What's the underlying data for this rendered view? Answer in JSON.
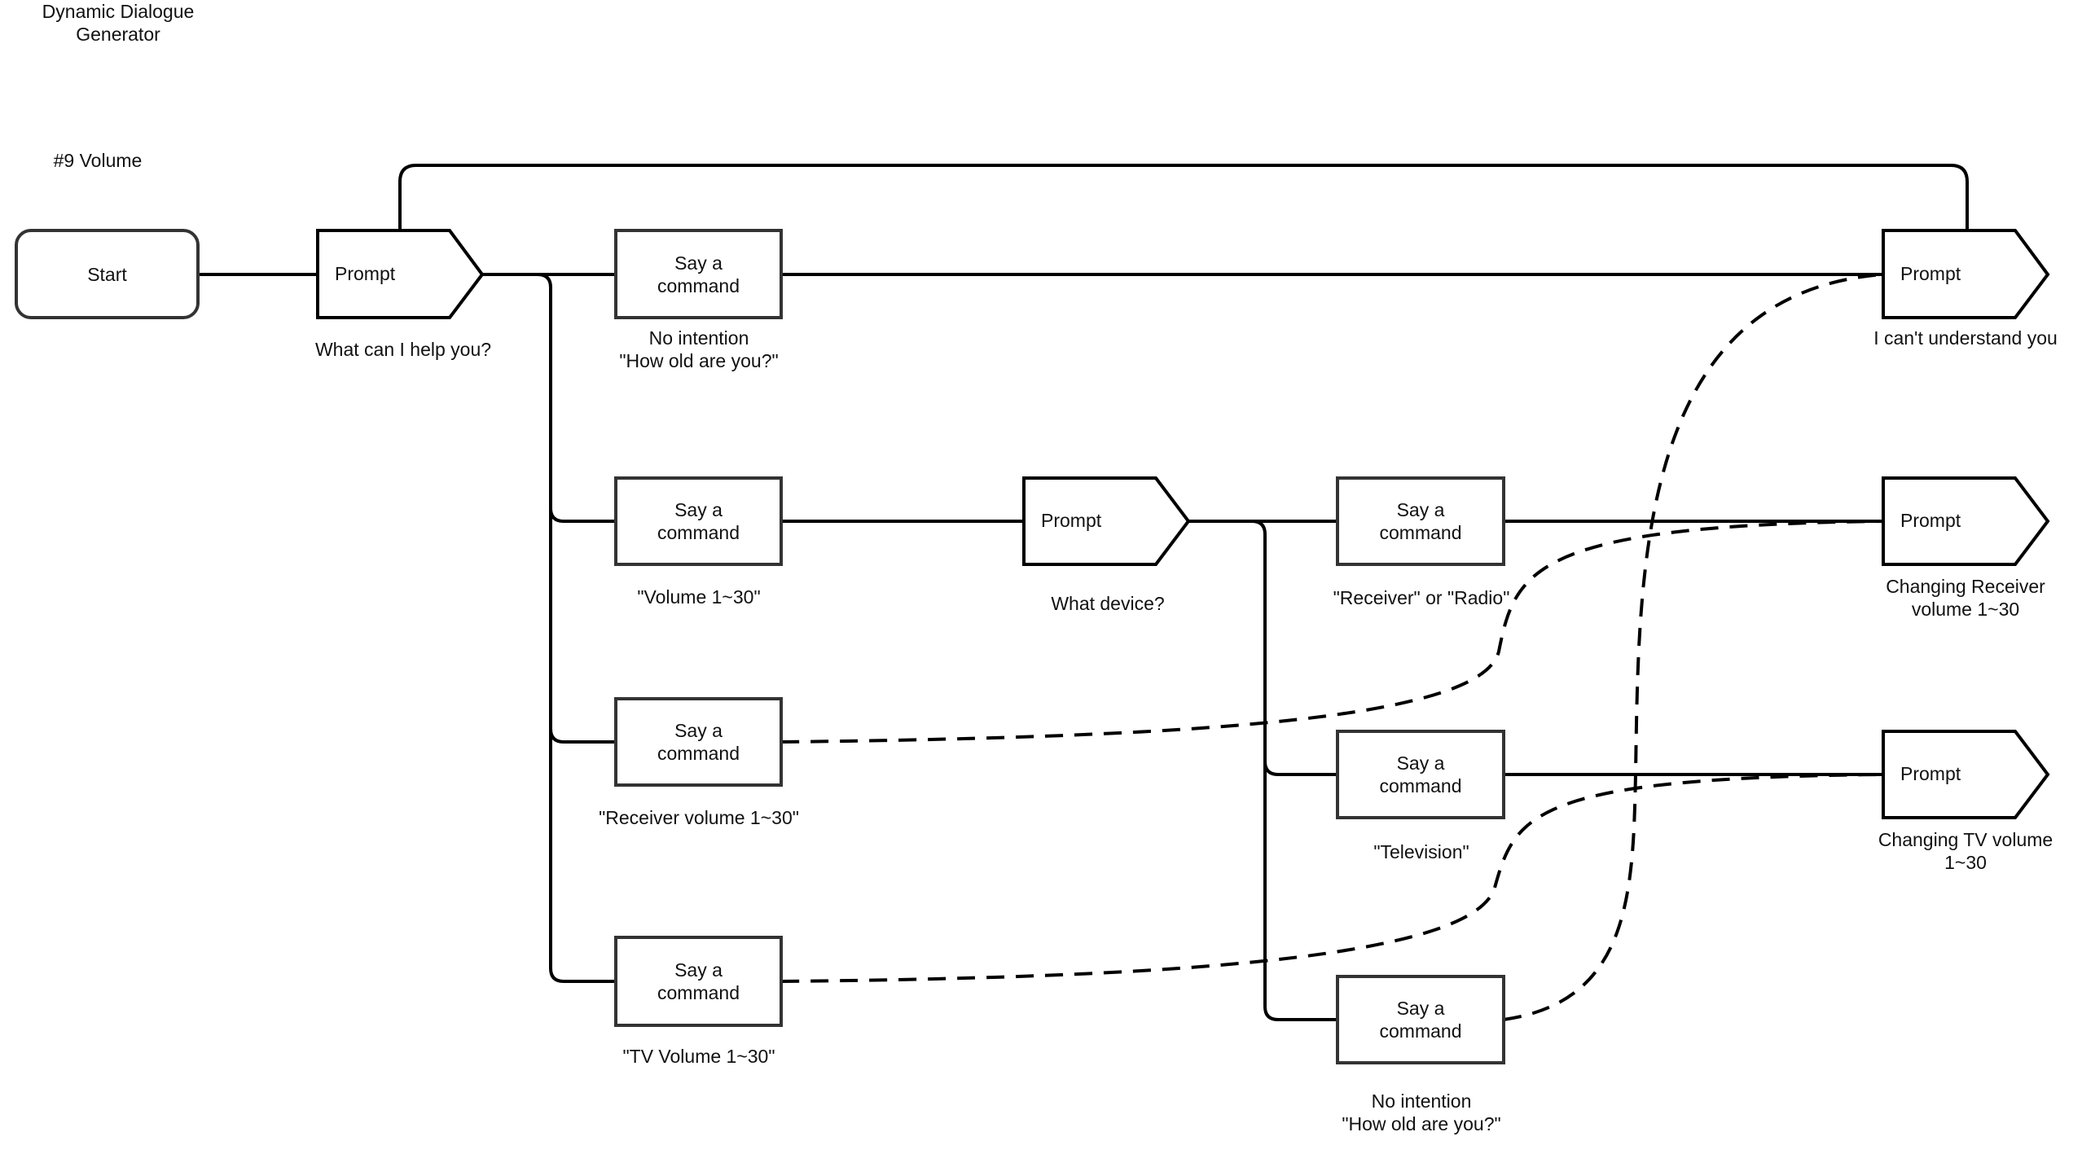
{
  "header": {
    "title_line1": "Dynamic Dialogue",
    "title_line2": "Generator",
    "section": "#9 Volume"
  },
  "nodes": {
    "start": {
      "label": "Start"
    },
    "prompt_main": {
      "label": "Prompt",
      "caption": "What can I help you?"
    },
    "say_no_intent_1": {
      "line1": "Say a",
      "line2": "command",
      "caption_line1": "No intention",
      "caption_line2": "\"How old are you?\""
    },
    "say_volume": {
      "line1": "Say a",
      "line2": "command",
      "caption": "\"Volume 1~30\""
    },
    "say_receiver_volume": {
      "line1": "Say a",
      "line2": "command",
      "caption": "\"Receiver volume 1~30\""
    },
    "say_tv_volume": {
      "line1": "Say a",
      "line2": "command",
      "caption": "\"TV Volume 1~30\""
    },
    "prompt_device": {
      "label": "Prompt",
      "caption": "What device?"
    },
    "say_receiver": {
      "line1": "Say a",
      "line2": "command",
      "caption": "\"Receiver\" or \"Radio\""
    },
    "say_television": {
      "line1": "Say a",
      "line2": "command",
      "caption": "\"Television\""
    },
    "say_no_intent_2": {
      "line1": "Say a",
      "line2": "command",
      "caption_line1": "No intention",
      "caption_line2": "\"How old are you?\""
    },
    "prompt_cant_understand": {
      "label": "Prompt",
      "caption": "I can't understand you"
    },
    "prompt_receiver_volume": {
      "label": "Prompt",
      "caption_line1": "Changing Receiver",
      "caption_line2": "volume 1~30"
    },
    "prompt_tv_volume": {
      "label": "Prompt",
      "caption_line1": "Changing TV volume",
      "caption_line2": "1~30"
    }
  },
  "colors": {
    "stroke": "#000000",
    "box_stroke": "#333333",
    "background": "#ffffff"
  }
}
